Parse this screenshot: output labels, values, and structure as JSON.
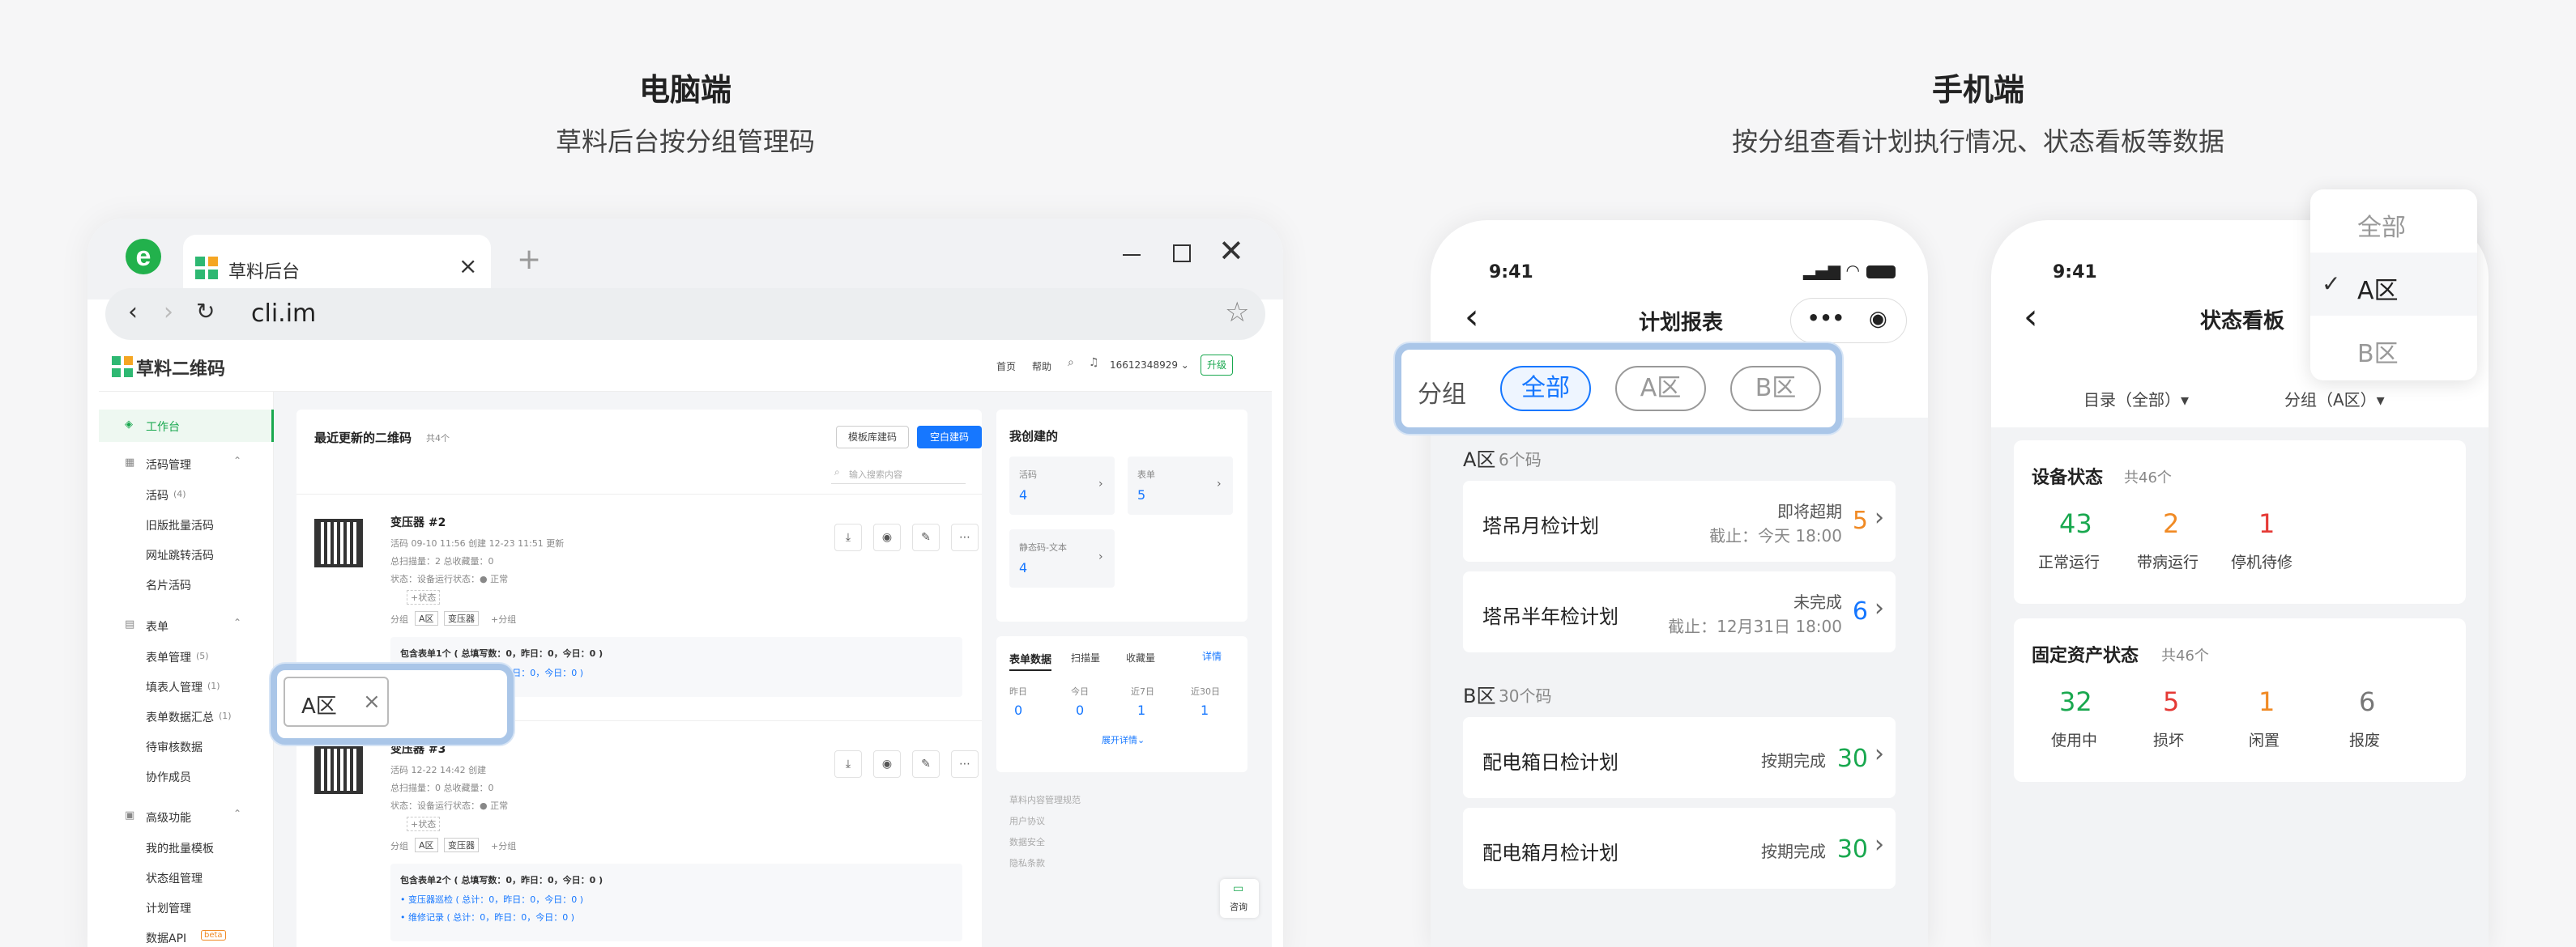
{
  "left_heading": {
    "title": "电脑端",
    "subtitle": "草料后台按分组管理码"
  },
  "right_heading": {
    "title": "手机端",
    "subtitle": "按分组查看计划执行情况、状态看板等数据"
  },
  "browser": {
    "tab_title": "草料后台",
    "tab_close": "×",
    "new_tab": "+",
    "url": "cli.im",
    "star": "☆"
  },
  "site": {
    "logo": "草料二维码",
    "header_links": [
      "首页",
      "帮助"
    ],
    "account": "16612348929 ⌄",
    "upgrade": "升级",
    "sidebar": {
      "workbench": "工作台",
      "live_code_group": "活码管理",
      "live_code_items": [
        "活码",
        "旧版批量活码",
        "网址跳转活码",
        "名片活码"
      ],
      "live_code_count": "(4)",
      "form_group": "表单",
      "form_items": [
        "表单管理",
        "填表人管理",
        "表单数据汇总",
        "待审核数据",
        "协作成员"
      ],
      "form_counts": [
        "(5)",
        "(1)",
        "(1)",
        "",
        ""
      ],
      "advanced_group": "高级功能",
      "advanced_items": [
        "我的批量模板",
        "状态组管理",
        "计划管理",
        "数据API"
      ],
      "beta": "beta"
    },
    "main": {
      "title": "最近更新的二维码",
      "title_count": "共4个",
      "template_btn": "模板库建码",
      "blank_btn": "空白建码",
      "search_placeholder": "输入搜索内容",
      "tag_popup": "A区",
      "tag_popup_close": "×",
      "items": [
        {
          "title": "变压器 #2",
          "meta": "活码  09-10 11:56 创建  12-23 11:51 更新",
          "stats": "总扫描量：2  总收藏量：0",
          "status": "状态：设备运行状态：● 正常",
          "add_status": "+状态",
          "group_label": "分组",
          "tags": [
            "A区",
            "变压器"
          ],
          "add_group": "+分组",
          "form_summary": "包含表单1个 ( 总填写数：0，昨日：0，今日：0 )",
          "form_lines": [
            "变压器巡检 ( 总计：0，昨日：0，今日：0 )"
          ]
        },
        {
          "title": "变压器 #3",
          "meta": "活码  12-22 14:42 创建",
          "stats": "总扫描量：0  总收藏量：0",
          "status": "状态：设备运行状态：● 正常",
          "add_status": "+状态",
          "group_label": "分组",
          "tags": [
            "A区",
            "变压器"
          ],
          "add_group": "+分组",
          "form_summary": "包含表单2个 ( 总填写数：0，昨日：0，今日：0 )",
          "form_lines": [
            "变压器巡检 ( 总计：0，昨日：0，今日：0 )",
            "维修记录 ( 总计：0，昨日：0，今日：0 )"
          ]
        }
      ]
    },
    "right_panel": {
      "title": "我创建的",
      "cards": [
        {
          "label": "活码",
          "value": "4"
        },
        {
          "label": "表单",
          "value": "5"
        },
        {
          "label": "静态码-文本",
          "value": "4"
        }
      ],
      "tabs": [
        "表单数据",
        "扫描量",
        "收藏量"
      ],
      "detail": "详情",
      "periods": [
        "昨日",
        "今日",
        "近7日",
        "近30日"
      ],
      "period_values": [
        "0",
        "0",
        "1",
        "1"
      ],
      "expand": "展开详情⌄",
      "links": [
        "草料内容管理规范",
        "用户协议",
        "数据安全",
        "隐私条款"
      ],
      "consult": "咨询"
    }
  },
  "phone1": {
    "time": "9:41",
    "title": "计划报表",
    "filter_label": "分组",
    "chips": [
      "全部",
      "A区",
      "B区"
    ],
    "sections": [
      {
        "name": "A区",
        "count": "6个码",
        "rows": [
          {
            "name": "塔吊月检计划",
            "status": "即将超期",
            "deadline": "截止：今天 18:00",
            "value": "5",
            "color": "orange"
          },
          {
            "name": "塔吊半年检计划",
            "status": "未完成",
            "deadline": "截止：12月31日 18:00",
            "value": "6",
            "color": "blue"
          }
        ]
      },
      {
        "name": "B区",
        "count": "30个码",
        "rows": [
          {
            "name": "配电箱日检计划",
            "status": "按期完成",
            "deadline": "",
            "value": "30",
            "color": "green"
          },
          {
            "name": "配电箱月检计划",
            "status": "按期完成",
            "deadline": "",
            "value": "30",
            "color": "green"
          }
        ]
      }
    ]
  },
  "phone2": {
    "time": "9:41",
    "title": "状态看板",
    "filters": [
      "目录（全部）▾",
      "分组（A区）▾"
    ],
    "dropdown": [
      "全部",
      "A区",
      "B区"
    ],
    "dropdown_selected": "A区",
    "check": "✓",
    "device_card": {
      "title": "设备状态",
      "count": "共46个",
      "stats": [
        {
          "value": "43",
          "label": "正常运行",
          "color": "green"
        },
        {
          "value": "2",
          "label": "带病运行",
          "color": "orange"
        },
        {
          "value": "1",
          "label": "停机待修",
          "color": "red"
        }
      ]
    },
    "asset_card": {
      "title": "固定资产状态",
      "count": "共46个",
      "stats": [
        {
          "value": "32",
          "label": "使用中",
          "color": "green"
        },
        {
          "value": "5",
          "label": "损坏",
          "color": "red"
        },
        {
          "value": "1",
          "label": "闲置",
          "color": "orange"
        },
        {
          "value": "6",
          "label": "报废",
          "color": "grey"
        }
      ]
    }
  },
  "colors": {
    "accent": "#1677ff",
    "green": "#19a84f",
    "orange": "#f08a24",
    "red": "#e53935",
    "highlight": "#aac6e8"
  }
}
